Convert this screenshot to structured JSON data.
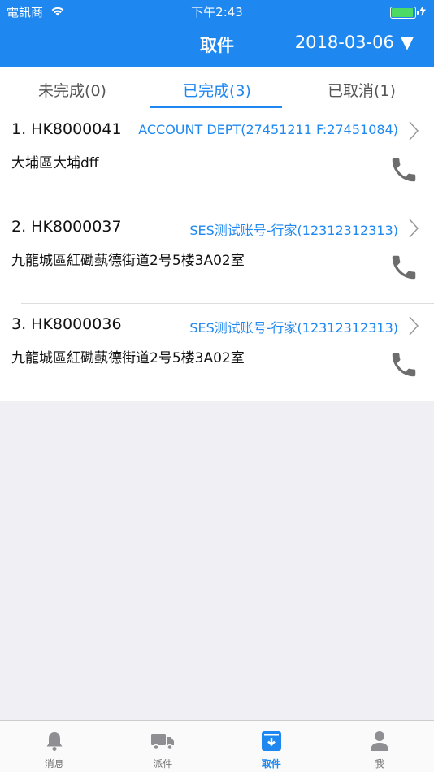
{
  "status": {
    "carrier": "電訊商",
    "time": "下午2:43"
  },
  "header": {
    "title": "取件",
    "date": "2018-03-06",
    "dropdown_glyph": "▼"
  },
  "tabs": [
    {
      "label": "未完成(0)"
    },
    {
      "label": "已完成(3)"
    },
    {
      "label": "已取消(1)"
    }
  ],
  "items": [
    {
      "code": "1. HK8000041",
      "account": "ACCOUNT DEPT(27451211 F:27451084)",
      "address": "大埔區大埔dff"
    },
    {
      "code": "2. HK8000037",
      "account": "SES测试账号-行家(12312312313)",
      "address": "九龍城區紅磡蓺德街道2号5楼3A02室"
    },
    {
      "code": "3. HK8000036",
      "account": "SES测试账号-行家(12312312313)",
      "address": "九龍城區紅磡蓺德街道2号5楼3A02室"
    }
  ],
  "tabbar": [
    {
      "label": "消息",
      "icon": "bell-icon"
    },
    {
      "label": "派件",
      "icon": "truck-icon"
    },
    {
      "label": "取件",
      "icon": "pickup-box-icon"
    },
    {
      "label": "我",
      "icon": "person-icon"
    }
  ],
  "colors": {
    "brand": "#1e88f0",
    "battery": "#4cd964"
  }
}
